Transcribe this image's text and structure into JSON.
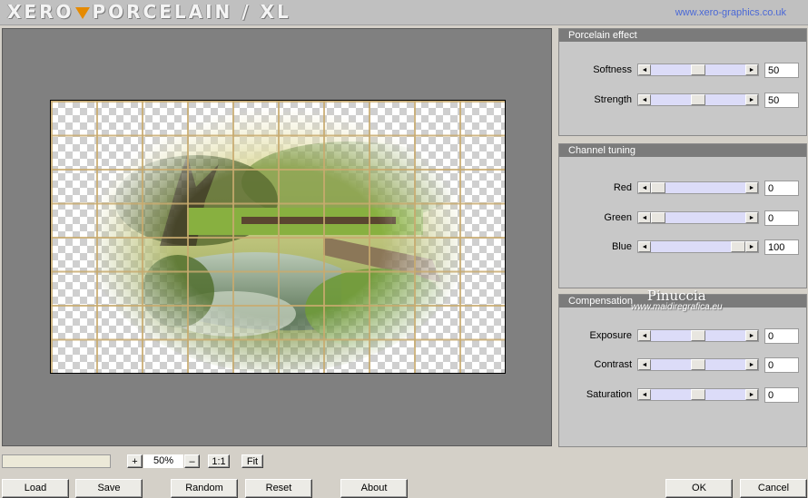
{
  "header": {
    "logo_text_left": "XERO",
    "logo_text_right": "PORCELAIN / XL",
    "site_url": "www.xero-graphics.co.uk"
  },
  "panels": {
    "porcelain": {
      "title": "Porcelain effect",
      "params": [
        {
          "label": "Softness",
          "value": "50",
          "position": 0.5
        },
        {
          "label": "Strength",
          "value": "50",
          "position": 0.5
        }
      ]
    },
    "channel": {
      "title": "Channel tuning",
      "params": [
        {
          "label": "Red",
          "value": "0",
          "position": 0
        },
        {
          "label": "Green",
          "value": "0",
          "position": 0
        },
        {
          "label": "Blue",
          "value": "100",
          "position": 1
        }
      ]
    },
    "compensation": {
      "title": "Compensation",
      "params": [
        {
          "label": "Exposure",
          "value": "0",
          "position": 0.5
        },
        {
          "label": "Contrast",
          "value": "0",
          "position": 0.5
        },
        {
          "label": "Saturation",
          "value": "0",
          "position": 0.5
        }
      ]
    }
  },
  "watermark": {
    "name": "Pinuccia",
    "url": "www.maidiregrafica.eu"
  },
  "zoom": {
    "plus_label": "+",
    "value": "50%",
    "minus_label": "–",
    "one_to_one_label": "1:1",
    "fit_label": "Fit"
  },
  "buttons": {
    "load": "Load",
    "save": "Save",
    "random": "Random",
    "reset": "Reset",
    "about": "About",
    "ok": "OK",
    "cancel": "Cancel"
  },
  "colors": {
    "panel_header": "#7b7b7b",
    "slider_track": "#dcdcf8",
    "url_blue": "#4a68d6",
    "logo_accent": "#e58a00"
  }
}
